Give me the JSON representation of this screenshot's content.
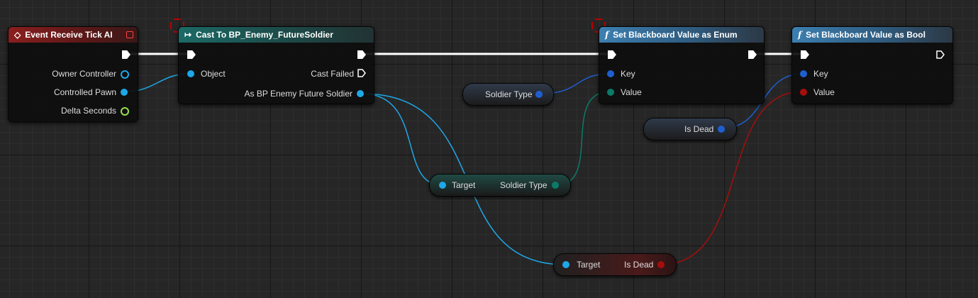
{
  "event_node": {
    "title": "Event Receive Tick AI",
    "pins": [
      "Owner Controller",
      "Controlled Pawn",
      "Delta Seconds"
    ]
  },
  "cast_node": {
    "title": "Cast To BP_Enemy_FutureSoldier",
    "object_label": "Object",
    "cast_failed_label": "Cast Failed",
    "output_label": "As BP Enemy Future Soldier"
  },
  "set_enum_node": {
    "title": "Set Blackboard Value as Enum",
    "key_label": "Key",
    "value_label": "Value"
  },
  "set_bool_node": {
    "title": "Set Blackboard Value as Bool",
    "key_label": "Key",
    "value_label": "Value"
  },
  "soldier_type_var": {
    "label": "Soldier Type"
  },
  "is_dead_var": {
    "label": "Is Dead"
  },
  "get_soldier_type": {
    "target_label": "Target",
    "output_label": "Soldier Type"
  },
  "get_is_dead": {
    "target_label": "Target",
    "output_label": "Is Dead"
  },
  "colors": {
    "object_pin": "#1ea8e8",
    "key_pin": "#1e5fd0",
    "enum_pin": "#0c7a68",
    "bool_pin": "#a50e0e",
    "float_pin": "#9be04a",
    "exec": "#ffffff"
  },
  "icons": {
    "event": "event-diamond-icon",
    "cast": "cast-arrow-icon",
    "function": "function-f-icon",
    "breakpoint": "breakpoint-octagon-icon"
  }
}
